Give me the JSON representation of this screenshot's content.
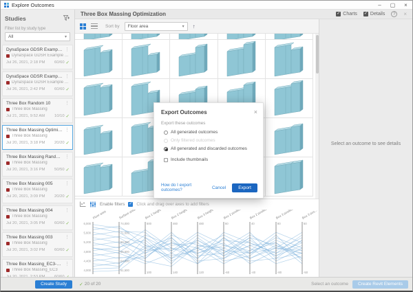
{
  "titlebar": {
    "title": "Explore Outcomes"
  },
  "sidebar": {
    "header": "Studies",
    "filter_label": "Filter list by study type",
    "filter_value": "All",
    "create_button": "Create Study",
    "studies": [
      {
        "title": "DynaSpace GDSR Example with Roo...",
        "subtitle": "DynaSpace GDSR Example with Roo...",
        "date": "Jul 26, 2021, 2:18 PM",
        "count": "60/60",
        "selected": false
      },
      {
        "title": "DynaSpace GDSR Example with Roo...",
        "subtitle": "DynaSpace GDSR Example with Roo...",
        "date": "Jul 26, 2021, 2:42 PM",
        "count": "60/60",
        "selected": false
      },
      {
        "title": "Three Box Random 10",
        "subtitle": "Three Box Massing",
        "date": "Jul 21, 2021, 9:52 AM",
        "count": "10/10",
        "selected": false
      },
      {
        "title": "Three Box Massing Optimization",
        "subtitle": "Three Box Massing",
        "date": "Jul 20, 2021, 3:18 PM",
        "count": "20/20",
        "selected": true
      },
      {
        "title": "Three Box Massing Randomize",
        "subtitle": "Three Box Massing",
        "date": "Jul 20, 2021, 3:16 PM",
        "count": "50/50",
        "selected": false
      },
      {
        "title": "Three Box Massing 005",
        "subtitle": "Three Box Massing",
        "date": "Jul 20, 2021, 3:09 PM",
        "count": "20/20",
        "selected": false
      },
      {
        "title": "Three Box Massing 004",
        "subtitle": "Three Box Massing",
        "date": "Jul 20, 2021, 3:05 PM",
        "count": "60/60",
        "selected": false
      },
      {
        "title": "Three Box Massing 003",
        "subtitle": "Three Box Massing",
        "date": "Jul 20, 2021, 3:02 PM",
        "count": "60/60",
        "selected": false
      },
      {
        "title": "Three Box Massing_EC3-002",
        "subtitle": "Three Box Massing_EC3",
        "date": "Jul 20, 2021, 2:53 PM",
        "count": "60/60",
        "selected": false
      }
    ]
  },
  "header": {
    "title": "Three Box Massing Optimization",
    "charts_label": "Charts",
    "details_label": "Details"
  },
  "toolbar": {
    "sort_label": "Sort by",
    "sort_value": "Floor area"
  },
  "details_panel": {
    "placeholder": "Select an outcome to see details"
  },
  "filter_bar": {
    "enable_label": "Enable filters",
    "hint": "Click and drag over axes to add filters"
  },
  "modal": {
    "title": "Export Outcomes",
    "section_label": "Export these outcomes",
    "options": [
      {
        "label": "All generated outcomes",
        "state": "unselected"
      },
      {
        "label": "Only filtered outcomes",
        "state": "disabled"
      },
      {
        "label": "All generated and discarded outcomes",
        "state": "selected"
      }
    ],
    "checkbox_label": "Include thumbnails",
    "help_link": "How do I export outcomes?",
    "cancel_label": "Cancel",
    "export_label": "Export"
  },
  "statusbar": {
    "count": "20 of 20",
    "hint": "Select an outcome",
    "action_label": "Create Revit Elements"
  },
  "colors": {
    "accent": "#2b7fd4",
    "export_blue": "#1b66c0",
    "disabled_button": "#a9cbe9",
    "thumb_front": "#8fc6d5",
    "thumb_side": "#6fa9bb",
    "thumb_top": "#b9dee8",
    "thumb_stroke": "#74aab9",
    "chart_line": "#7fb2dc",
    "selected_border": "#57a8e2",
    "check_green": "#7ab648",
    "badge_red": "#9e2b2b"
  },
  "chart_data": {
    "type": "parallel-coordinates",
    "legend_position": "none",
    "grid": false,
    "axes": [
      {
        "label": "Floor area",
        "ticks": [
          "6,000",
          "5,600",
          "5,200",
          "4,800",
          "4,400",
          "4,000"
        ]
      },
      {
        "label": "Surface area",
        "ticks": [
          "74,000",
          "71,500",
          "69,000",
          "66,500",
          "64,000",
          "61,500"
        ]
      },
      {
        "label": "Box 1 height",
        "ticks": [
          "500",
          "100"
        ]
      },
      {
        "label": "Box 2 height",
        "ticks": [
          "460",
          "140"
        ]
      },
      {
        "label": "Box 3 height",
        "ticks": [
          "480",
          "120"
        ]
      },
      {
        "label": "Box 2 position x",
        "ticks": [
          "60",
          "-60"
        ]
      },
      {
        "label": "Box 2 position y",
        "ticks": [
          "40",
          "-40"
        ]
      },
      {
        "label": "Box 3 position x",
        "ticks": [
          "80",
          "-80"
        ]
      },
      {
        "label": "Box 3 pos...",
        "ticks": [
          "50",
          "-50"
        ]
      }
    ],
    "lines": [
      [
        0.05,
        0.12,
        0.3,
        0.55,
        0.2,
        0.44,
        0.6,
        0.3,
        0.5
      ],
      [
        0.1,
        0.2,
        0.5,
        0.3,
        0.7,
        0.2,
        0.4,
        0.6,
        0.25
      ],
      [
        0.15,
        0.08,
        0.45,
        0.7,
        0.35,
        0.6,
        0.3,
        0.45,
        0.7
      ],
      [
        0.2,
        0.3,
        0.6,
        0.4,
        0.5,
        0.8,
        0.55,
        0.2,
        0.4
      ],
      [
        0.25,
        0.18,
        0.2,
        0.6,
        0.8,
        0.3,
        0.7,
        0.5,
        0.6
      ],
      [
        0.3,
        0.4,
        0.7,
        0.25,
        0.45,
        0.5,
        0.2,
        0.7,
        0.35
      ],
      [
        0.35,
        0.28,
        0.4,
        0.8,
        0.3,
        0.65,
        0.45,
        0.4,
        0.8
      ],
      [
        0.4,
        0.5,
        0.15,
        0.5,
        0.6,
        0.4,
        0.8,
        0.55,
        0.3
      ],
      [
        0.45,
        0.38,
        0.55,
        0.35,
        0.75,
        0.7,
        0.35,
        0.65,
        0.45
      ],
      [
        0.5,
        0.6,
        0.8,
        0.6,
        0.25,
        0.55,
        0.6,
        0.35,
        0.55
      ],
      [
        0.55,
        0.48,
        0.35,
        0.75,
        0.5,
        0.25,
        0.5,
        0.8,
        0.65
      ],
      [
        0.6,
        0.7,
        0.6,
        0.2,
        0.65,
        0.6,
        0.25,
        0.5,
        0.2
      ],
      [
        0.65,
        0.58,
        0.25,
        0.45,
        0.4,
        0.75,
        0.65,
        0.25,
        0.75
      ],
      [
        0.7,
        0.8,
        0.5,
        0.65,
        0.55,
        0.35,
        0.4,
        0.6,
        0.4
      ],
      [
        0.75,
        0.68,
        0.7,
        0.3,
        0.8,
        0.5,
        0.7,
        0.45,
        0.6
      ],
      [
        0.8,
        0.85,
        0.45,
        0.55,
        0.35,
        0.65,
        0.3,
        0.75,
        0.5
      ],
      [
        0.85,
        0.78,
        0.65,
        0.4,
        0.6,
        0.45,
        0.55,
        0.4,
        0.7
      ],
      [
        0.9,
        0.88,
        0.3,
        0.7,
        0.5,
        0.7,
        0.45,
        0.65,
        0.35
      ],
      [
        0.95,
        0.93,
        0.55,
        0.5,
        0.7,
        0.3,
        0.6,
        0.5,
        0.55
      ],
      [
        0.5,
        0.55,
        0.75,
        0.85,
        0.45,
        0.55,
        0.75,
        0.7,
        0.6
      ]
    ]
  },
  "thumbnails": [
    [
      38,
      30
    ],
    [
      40,
      26
    ],
    [
      28,
      38
    ],
    [
      36,
      42
    ],
    [
      42,
      34
    ],
    [
      40,
      36
    ],
    [
      42,
      28
    ],
    [
      30,
      34
    ],
    [
      34,
      40
    ],
    [
      38,
      42
    ],
    [
      36,
      26
    ],
    [
      40,
      34
    ],
    [
      32,
      40
    ],
    [
      42,
      30
    ],
    [
      34,
      36
    ],
    [
      38,
      34
    ],
    [
      30,
      42
    ],
    [
      42,
      38
    ],
    [
      36,
      30
    ],
    [
      40,
      40
    ]
  ],
  "thumbnails_sliver": [
    [
      36,
      30
    ],
    [
      40,
      28
    ],
    [
      34,
      38
    ],
    [
      38,
      32
    ],
    [
      36,
      40
    ]
  ]
}
